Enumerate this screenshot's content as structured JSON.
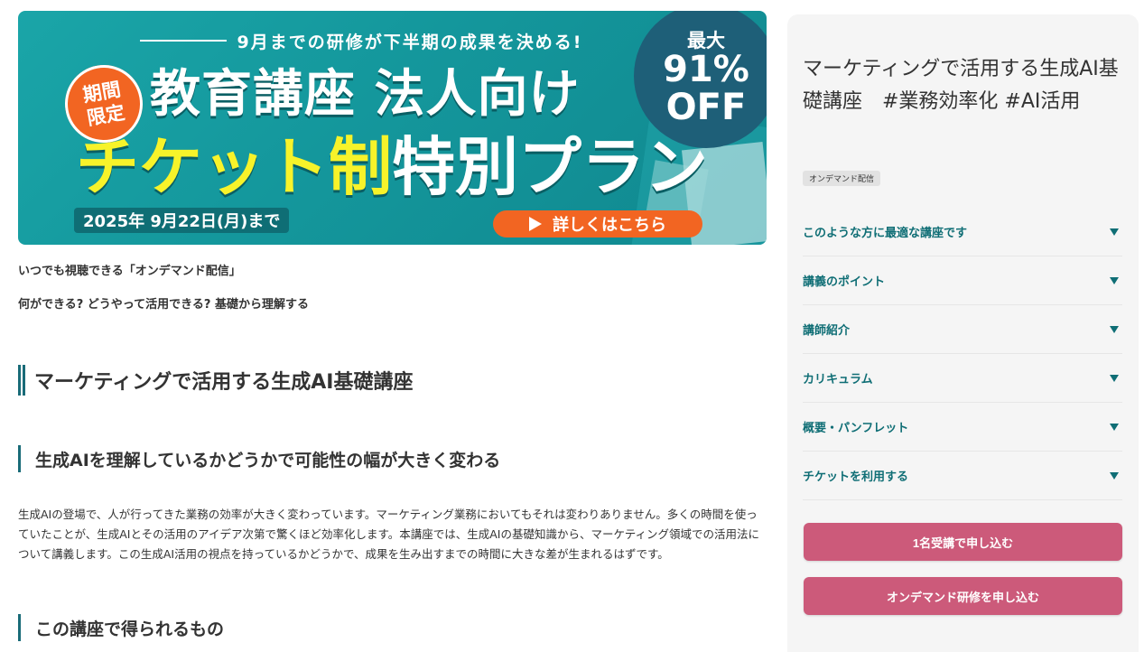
{
  "banner": {
    "tagline": "9月までの研修が下半期の成果を決める!",
    "badge_line1": "期間",
    "badge_line2": "限定",
    "headline1": "教育講座 法人向け",
    "headline2_highlight": "チケット制",
    "headline2_rest": "特別プラン",
    "offer_small": "最大",
    "offer_big": "91%",
    "offer_off": "OFF",
    "date_text": "2025年 9月22日(月)まで",
    "cta_text": "詳しくはこちら",
    "colors": {
      "bg": "#14979c",
      "orange": "#f26522",
      "yellow": "#f7f32a",
      "navy": "#1e5f78"
    }
  },
  "main": {
    "intro1": "いつでも視聴できる「オンデマンド配信」",
    "intro2": "何ができる? どうやって活用できる? 基礎から理解する",
    "h2": "マーケティングで活用する生成AI基礎講座",
    "h3_1": "生成AIを理解しているかどうかで可能性の幅が大きく変わる",
    "paragraph": "生成AIの登場で、人が行ってきた業務の効率が大きく変わっています。マーケティング業務においてもそれは変わりありません。多くの時間を使っていたことが、生成AIとその活用のアイデア次第で驚くほど効率化します。本講座では、生成AIの基礎知識から、マーケティング領域での活用法について講義します。この生成AI活用の視点を持っているかどうかで、成果を生み出すまでの時間に大きな差が生まれるはずです。",
    "h3_2": "この講座で得られるもの"
  },
  "sidebar": {
    "title": "マーケティングで活用する生成AI基礎講座　#業務効率化 #AI活用",
    "tag": "オンデマンド配信",
    "accordion": [
      {
        "label": "このような方に最適な講座です"
      },
      {
        "label": "講義のポイント"
      },
      {
        "label": "講師紹介"
      },
      {
        "label": "カリキュラム"
      },
      {
        "label": "概要・パンフレット"
      },
      {
        "label": "チケットを利用する"
      }
    ],
    "button1": "1名受講で申し込む",
    "button2": "オンデマンド研修を申し込む",
    "accent": "#0f6e75",
    "button_color": "#cc5a7a"
  }
}
